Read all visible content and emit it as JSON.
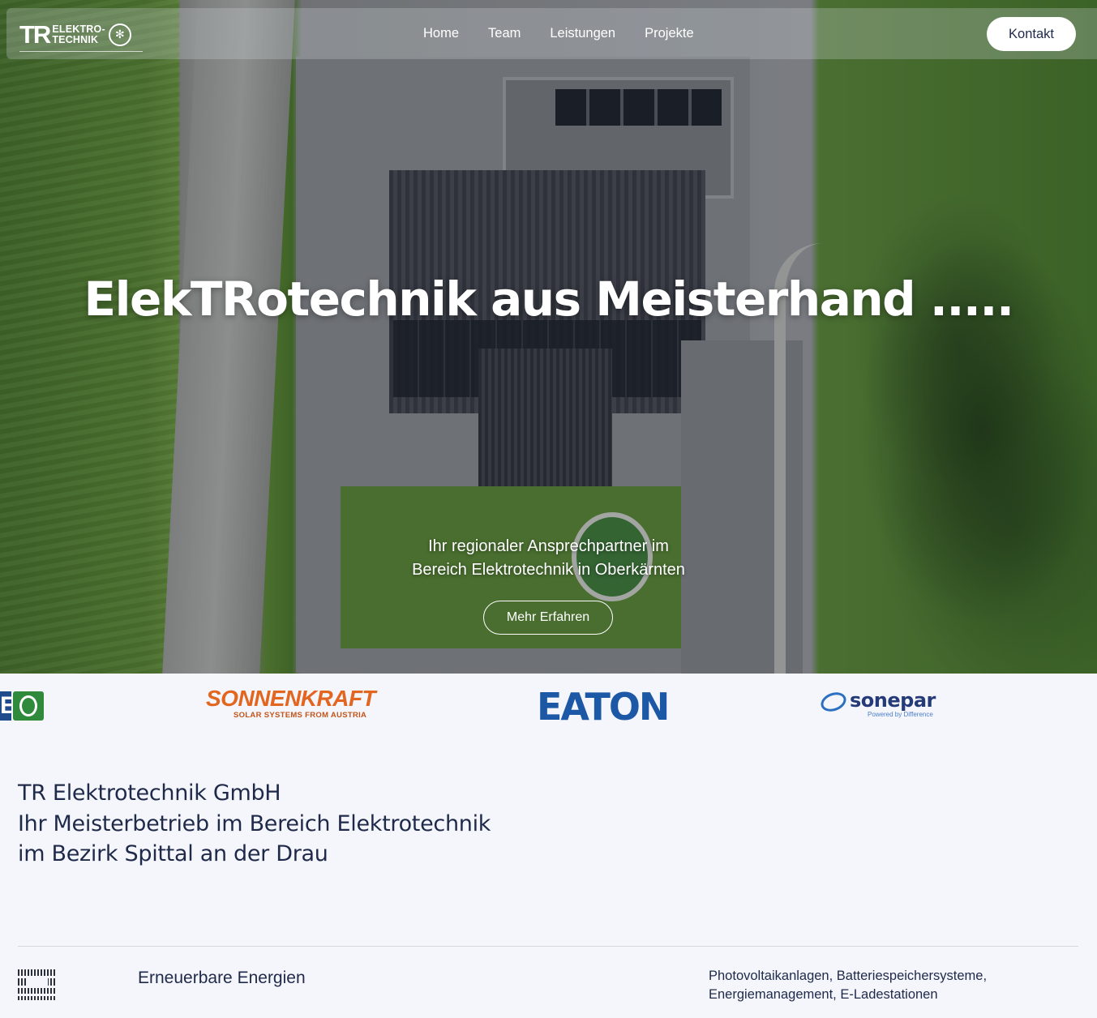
{
  "nav": {
    "logo": {
      "mark": "TR",
      "line1": "ELEKTRO-",
      "line2": "TECHNIK"
    },
    "links": [
      "Home",
      "Team",
      "Leistungen",
      "Projekte"
    ],
    "cta": "Kontakt"
  },
  "hero": {
    "title": "ElekTRotechnik aus Meisterhand .....",
    "subtitle_line1": "Ihr regionaler Ansprechpartner im",
    "subtitle_line2": "Bereich Elektrotechnik in Oberkärnten",
    "button": "Mehr Erfahren"
  },
  "partners": {
    "sonnenkraft": {
      "name": "SONNENKRAFT",
      "tagline": "SOLAR SYSTEMS FROM AUSTRIA"
    },
    "eaton": {
      "name": "EATON"
    },
    "sonepar": {
      "name": "sonepar",
      "tagline": "Powered by Difference"
    },
    "partial": {
      "letter": "E"
    }
  },
  "intro": {
    "line1": "TR Elektrotechnik GmbH",
    "line2": "Ihr Meisterbetrieb im Bereich Elektrotechnik",
    "line3": "im Bezirk Spittal an der Drau"
  },
  "service": {
    "icon": "solar-panel-icon",
    "title": "Erneuerbare Energien",
    "desc_line1": "Photovoltaikanlagen, Batteriespeichersysteme,",
    "desc_line2": "Energiemanagement, E-Ladestationen"
  },
  "colors": {
    "text": "#1f2a4a",
    "background": "#f5f6fb",
    "sonnenkraft": "#e2661f",
    "eaton": "#1c58a6",
    "sonepar": "#253b79"
  }
}
